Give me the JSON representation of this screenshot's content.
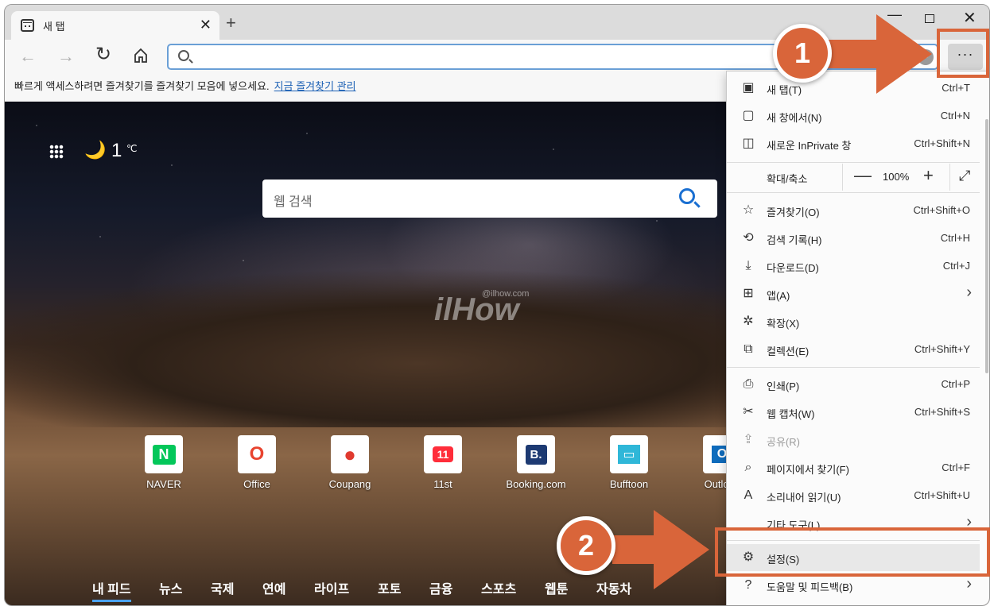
{
  "tab": {
    "title": "새 탭",
    "close": "✕",
    "new_tab": "+"
  },
  "window_controls": {
    "minimize": "—",
    "close": "✕"
  },
  "toolbar": {
    "back": "←",
    "forward": "→",
    "refresh": "↻",
    "more": "···"
  },
  "favorites_bar": {
    "text": "빠르게 액세스하려면 즐겨찾기를 즐겨찾기 모음에 넣으세요.",
    "link": "지금 즐겨찾기 관리"
  },
  "newtab": {
    "temperature": "1",
    "temperature_unit": "℃",
    "search_placeholder": "웹 검색",
    "watermark": "ilHow",
    "watermark_small": "@ilhow.com",
    "tiles": [
      {
        "label": "NAVER",
        "glyph": "N",
        "color": "#03c75a"
      },
      {
        "label": "Office",
        "glyph": "O",
        "color": "#e8442f"
      },
      {
        "label": "Coupang",
        "glyph": "●",
        "color": "#e03a2f"
      },
      {
        "label": "11st",
        "glyph": "11",
        "color": "#ff2d3a"
      },
      {
        "label": "Booking.com",
        "glyph": "B.",
        "color": "#1d3a72"
      },
      {
        "label": "Bufftoon",
        "glyph": "▭",
        "color": "#2fb7d8"
      },
      {
        "label": "Outlook",
        "glyph": "O",
        "color": "#0f6cbd"
      }
    ],
    "feed_nav": [
      "내 피드",
      "뉴스",
      "국제",
      "연예",
      "라이프",
      "포토",
      "금융",
      "스포츠",
      "웹툰",
      "자동차"
    ]
  },
  "menu": {
    "items": [
      {
        "label": "새 탭(T)",
        "shortcut": "Ctrl+T",
        "icon": "new-tab-icon"
      },
      {
        "label": "새 창에서(N)",
        "shortcut": "Ctrl+N",
        "icon": "new-window-icon"
      },
      {
        "label": "새로운 InPrivate 창",
        "shortcut": "Ctrl+Shift+N",
        "icon": "inprivate-icon"
      }
    ],
    "zoom": {
      "label": "확대/축소",
      "minus": "—",
      "value": "100%",
      "plus": "+",
      "fullscreen": "⤢"
    },
    "items2": [
      {
        "label": "즐겨찾기(O)",
        "shortcut": "Ctrl+Shift+O",
        "icon": "favorites-icon"
      },
      {
        "label": "검색 기록(H)",
        "shortcut": "Ctrl+H",
        "icon": "history-icon"
      },
      {
        "label": "다운로드(D)",
        "shortcut": "Ctrl+J",
        "icon": "download-icon"
      },
      {
        "label": "앱(A)",
        "shortcut": "",
        "icon": "apps-icon",
        "submenu": true
      },
      {
        "label": "확장(X)",
        "shortcut": "",
        "icon": "extensions-icon"
      },
      {
        "label": "컬렉션(E)",
        "shortcut": "Ctrl+Shift+Y",
        "icon": "collections-icon"
      }
    ],
    "items3": [
      {
        "label": "인쇄(P)",
        "shortcut": "Ctrl+P",
        "icon": "print-icon"
      },
      {
        "label": "웹 캡처(W)",
        "shortcut": "Ctrl+Shift+S",
        "icon": "web-capture-icon"
      },
      {
        "label": "공유(R)",
        "shortcut": "",
        "icon": "share-icon",
        "disabled": true
      },
      {
        "label": "페이지에서 찾기(F)",
        "shortcut": "Ctrl+F",
        "icon": "find-icon"
      },
      {
        "label": "소리내어 읽기(U)",
        "shortcut": "Ctrl+Shift+U",
        "icon": "read-aloud-icon"
      },
      {
        "label": "기타 도구(L)",
        "shortcut": "",
        "icon": "",
        "submenu": true
      }
    ],
    "settings": {
      "label": "설정(S)",
      "icon": "gear-icon"
    },
    "help": {
      "label": "도움말 및 피드백(B)",
      "icon": "help-icon"
    },
    "submenu_arrow": "›"
  },
  "annotations": {
    "step1": "1",
    "step2": "2",
    "accent": "#d9653a"
  }
}
